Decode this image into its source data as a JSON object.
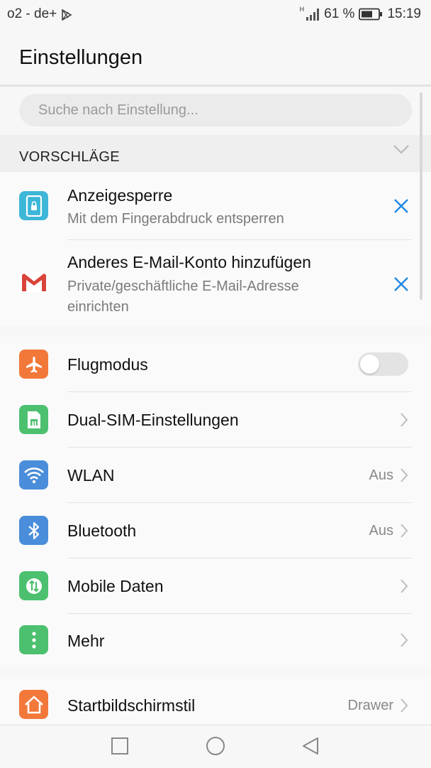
{
  "status_bar": {
    "carrier": "o2 - de+",
    "network": "H",
    "battery": "61 %",
    "time": "15:19"
  },
  "title": "Einstellungen",
  "search": {
    "placeholder": "Suche nach Einstellung..."
  },
  "suggestions": {
    "header": "VORSCHLÄGE",
    "items": [
      {
        "title": "Anzeigesperre",
        "subtitle": "Mit dem Fingerabdruck entsperren",
        "icon": "screen-lock-icon"
      },
      {
        "title": "Anderes E-Mail-Konto hinzufügen",
        "subtitle_line1": "Private/geschäftliche E-Mail-Adresse",
        "subtitle_line2": "einrichten",
        "icon": "gmail-icon"
      }
    ]
  },
  "settings": [
    {
      "label": "Flugmodus",
      "icon": "airplane-icon",
      "color": "#f2783a",
      "toggle": "off"
    },
    {
      "label": "Dual-SIM-Einstellungen",
      "icon": "sim-card-icon",
      "color": "#4cc06f"
    },
    {
      "label": "WLAN",
      "icon": "wifi-icon",
      "color": "#4a8ddb",
      "value": "Aus"
    },
    {
      "label": "Bluetooth",
      "icon": "bluetooth-icon",
      "color": "#4a8ddb",
      "value": "Aus"
    },
    {
      "label": "Mobile Daten",
      "icon": "mobile-data-icon",
      "color": "#4cc06f"
    },
    {
      "label": "Mehr",
      "icon": "more-icon",
      "color": "#4cc06f"
    }
  ],
  "launcher": {
    "label": "Startbildschirmstil",
    "icon": "home-icon",
    "color": "#f2783a",
    "value": "Drawer"
  },
  "accent_color": "#1e88e5"
}
